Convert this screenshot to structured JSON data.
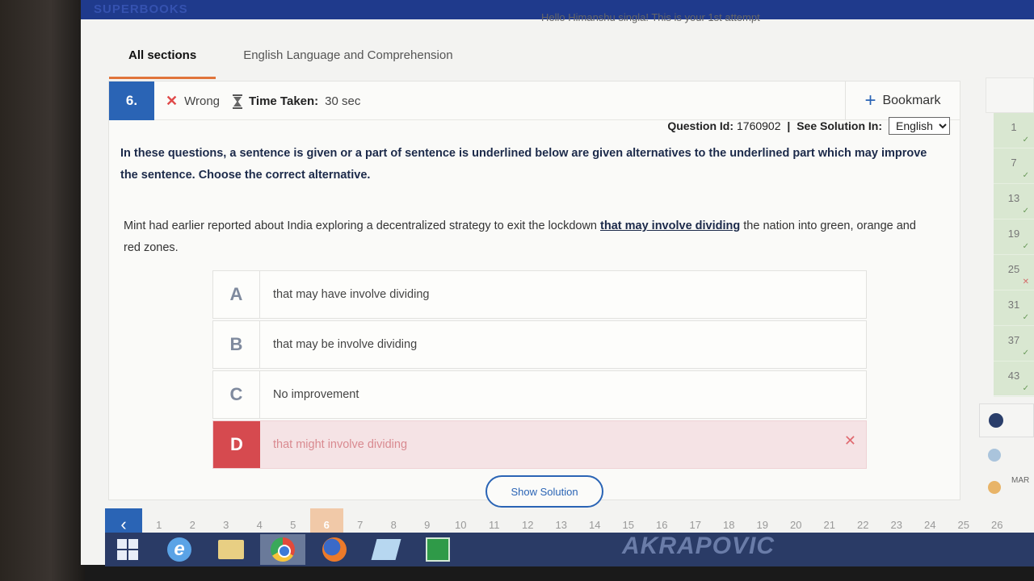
{
  "brand": "SUPERBOOKS",
  "greeting": "Hello Himanshu singla! This is your 1st attempt",
  "tabs": [
    {
      "label": "All sections"
    },
    {
      "label": "English Language and Comprehension"
    }
  ],
  "question": {
    "number": "6.",
    "status": "Wrong",
    "time_label": "Time Taken:",
    "time_value": "30 sec",
    "bookmark_label": "Bookmark",
    "id_label": "Question Id:",
    "id_value": "1760902",
    "see_solution_label": "See Solution In:",
    "language": "English",
    "instruction": "In these questions, a sentence is given or a part of sentence is underlined below are given alternatives to the underlined part which may improve the sentence. Choose the correct alternative.",
    "passage_before": "Mint had earlier reported about India exploring a decentralized strategy to exit the lockdown ",
    "passage_underlined": "that may involve dividing",
    "passage_after": " the nation into green, orange and red zones.",
    "options": [
      {
        "letter": "A",
        "text": "that may have involve dividing"
      },
      {
        "letter": "B",
        "text": "that may be involve dividing"
      },
      {
        "letter": "C",
        "text": "No improvement"
      },
      {
        "letter": "D",
        "text": "that might involve dividing"
      }
    ],
    "show_solution_label": "Show Solution"
  },
  "palette": [
    {
      "num": "1",
      "state": "correct"
    },
    {
      "num": "7",
      "state": "correct"
    },
    {
      "num": "13",
      "state": "correct"
    },
    {
      "num": "19",
      "state": "correct"
    },
    {
      "num": "25",
      "state": "wrong"
    },
    {
      "num": "31",
      "state": "correct"
    },
    {
      "num": "37",
      "state": "correct"
    },
    {
      "num": "43",
      "state": "correct"
    }
  ],
  "legend_label": "MAR",
  "nav_numbers": [
    "1",
    "2",
    "3",
    "4",
    "5",
    "6",
    "7",
    "8",
    "9",
    "10",
    "11",
    "12",
    "13",
    "14",
    "15",
    "16",
    "17",
    "18",
    "19",
    "20",
    "21",
    "22",
    "23",
    "24",
    "25",
    "26"
  ],
  "current_question": "6",
  "taskbar_watermark": "AKRAPOVIC",
  "colors": {
    "primary": "#2a64b5",
    "wrong": "#d64a4f",
    "tab_underline": "#e0743a"
  }
}
